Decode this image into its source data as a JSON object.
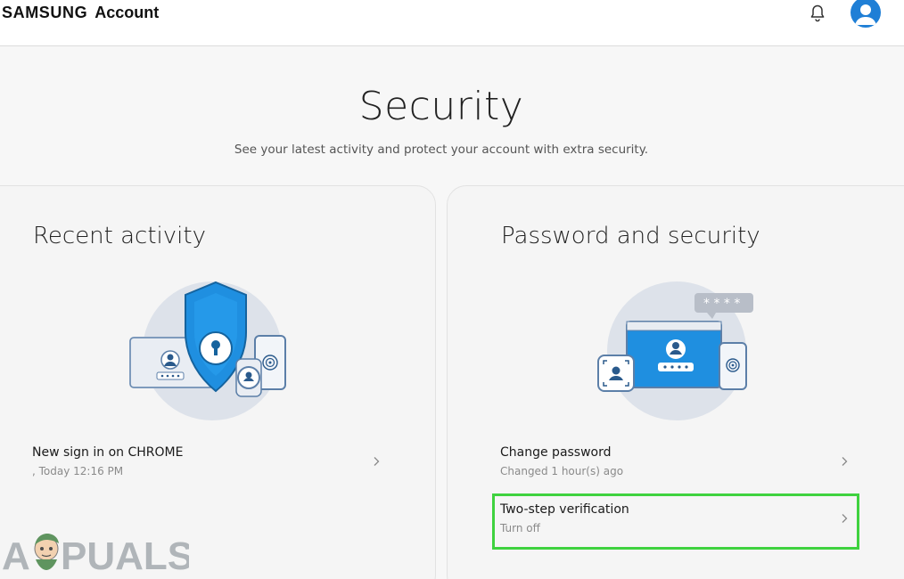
{
  "header": {
    "brand_samsung": "SAMSUNG",
    "brand_account": "Account"
  },
  "page": {
    "title": "Security",
    "subtitle": "See your latest activity and protect your account with extra security."
  },
  "recent_activity": {
    "title": "Recent activity",
    "items": [
      {
        "primary": "New sign in on CHROME",
        "secondary": ", Today 12:16 PM"
      }
    ]
  },
  "password_security": {
    "title": "Password and security",
    "items": [
      {
        "primary": "Change password",
        "secondary": "Changed 1 hour(s) ago"
      },
      {
        "primary": "Two-step verification",
        "secondary": "Turn off"
      }
    ]
  },
  "watermark": {
    "text": "APPUALS"
  },
  "colors": {
    "accent_blue": "#1f7fd6",
    "highlight_green": "#3fd23f",
    "illustration_bg": "#dde2ea"
  },
  "icons": [
    "bell-icon",
    "user-avatar-icon",
    "chevron-right-icon",
    "shield-illustration",
    "devices-illustration"
  ]
}
